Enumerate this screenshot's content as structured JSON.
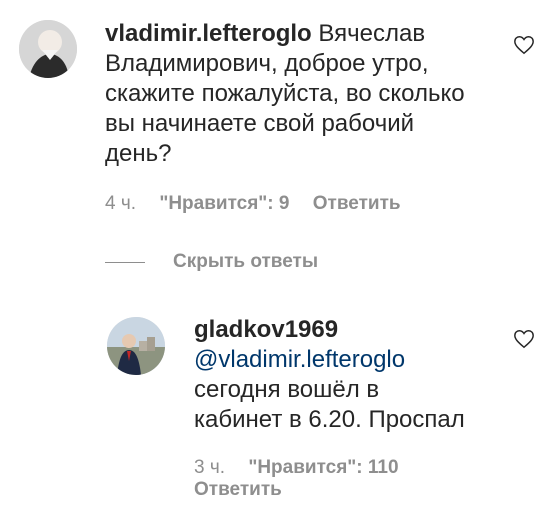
{
  "comments": [
    {
      "username": "vladimir.lefteroglo",
      "text_first": "Вячеслав",
      "lines": [
        "Владимирович, доброе утро,",
        "скажите пожалуйста, во сколько",
        "вы начинаете свой рабочий",
        "день?"
      ],
      "time": "4 ч.",
      "likes": "\"Нравится\": 9",
      "reply": "Ответить",
      "like_icon": "heart-outline-icon"
    }
  ],
  "toggle_replies_label": "Скрыть ответы",
  "replies": [
    {
      "username": "gladkov1969",
      "mention": "@vladimir.lefteroglo",
      "lines": [
        "сегодня вошёл в",
        "кабинет в 6.20. Проспал"
      ],
      "time": "3 ч.",
      "likes": "\"Нравится\": 110",
      "reply": "Ответить",
      "like_icon": "heart-outline-icon"
    }
  ],
  "colors": {
    "text": "#262626",
    "meta": "#8e8e8e",
    "mention": "#00376b"
  }
}
